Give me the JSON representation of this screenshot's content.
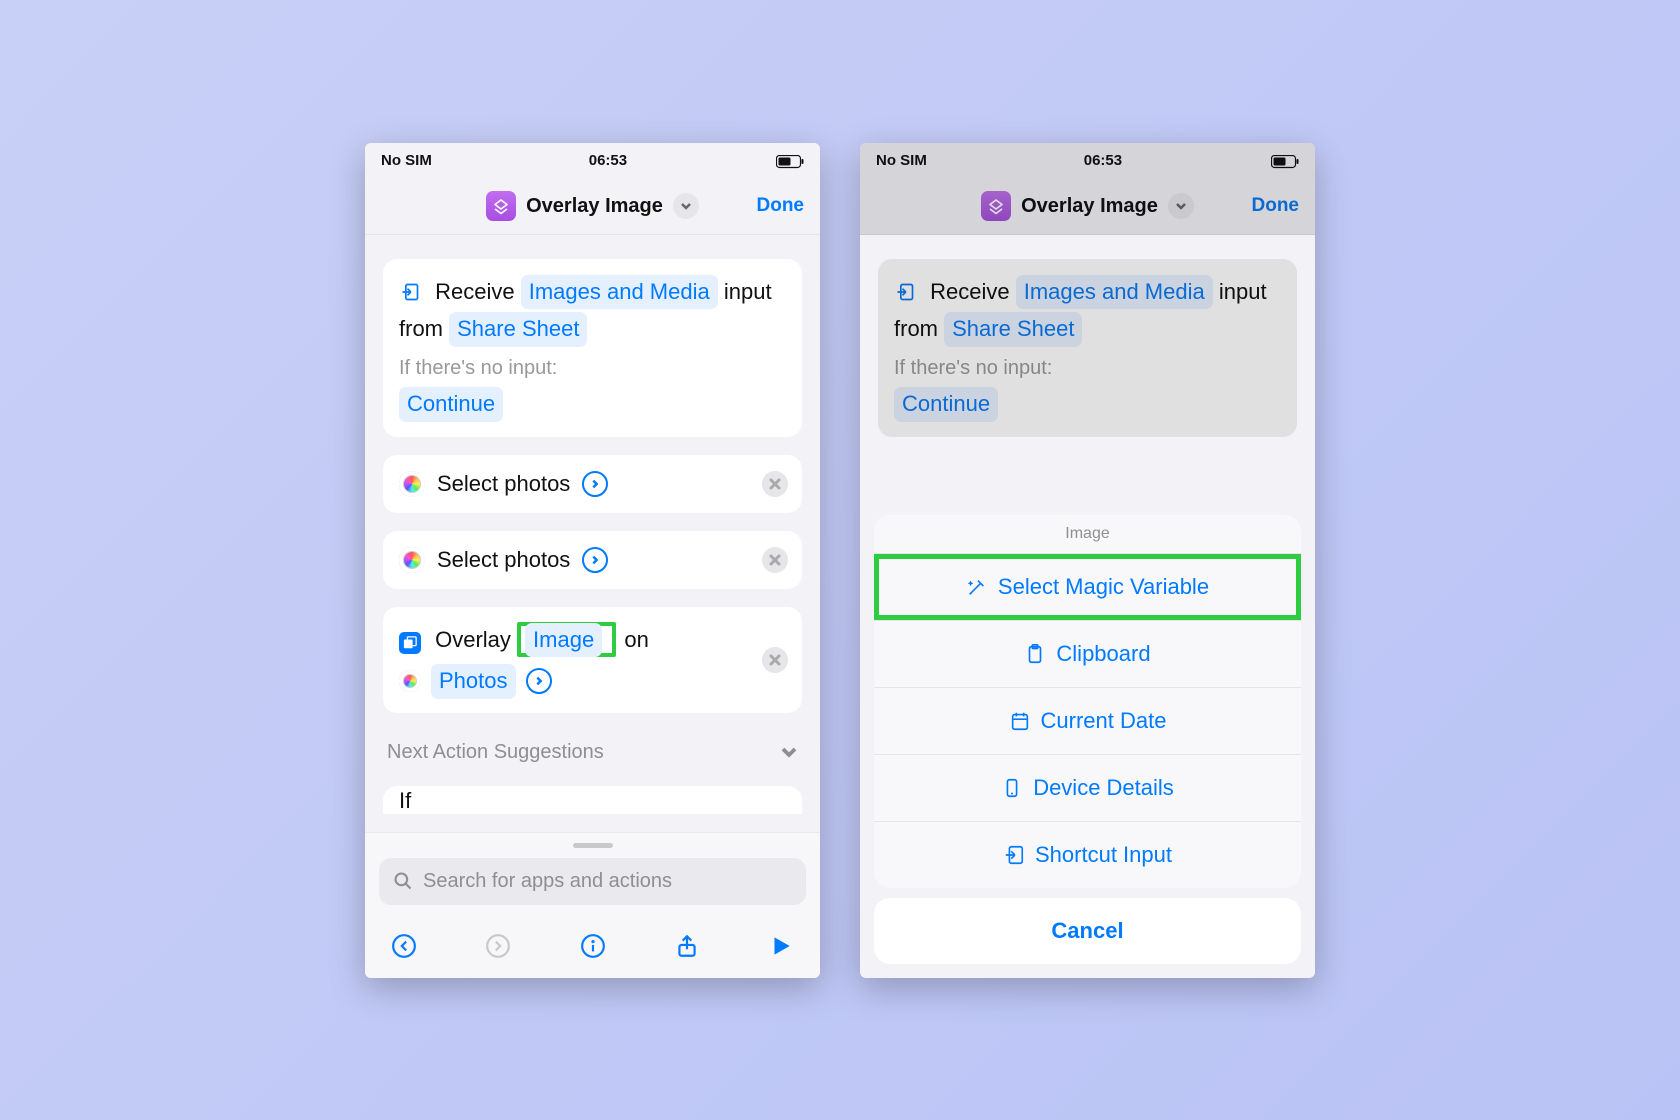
{
  "status": {
    "carrier": "No SIM",
    "time": "06:53"
  },
  "nav": {
    "title": "Overlay Image",
    "done": "Done"
  },
  "receive": {
    "word_receive": "Receive",
    "types_token": "Images and Media",
    "input_from": "input from",
    "source_token": "Share Sheet",
    "no_input_hint": "If there's no input:",
    "continue_token": "Continue"
  },
  "actions": {
    "select_photos": "Select photos"
  },
  "overlay": {
    "word_overlay": "Overlay",
    "image_token": "Image",
    "word_on": "on",
    "photos_token": "Photos"
  },
  "suggestions": {
    "label": "Next Action Suggestions",
    "truncated": "If"
  },
  "search": {
    "placeholder": "Search for apps and actions"
  },
  "sheet": {
    "header": "Image",
    "magic": "Select Magic Variable",
    "clipboard": "Clipboard",
    "date": "Current Date",
    "device": "Device Details",
    "shortcut": "Shortcut Input",
    "cancel": "Cancel"
  }
}
